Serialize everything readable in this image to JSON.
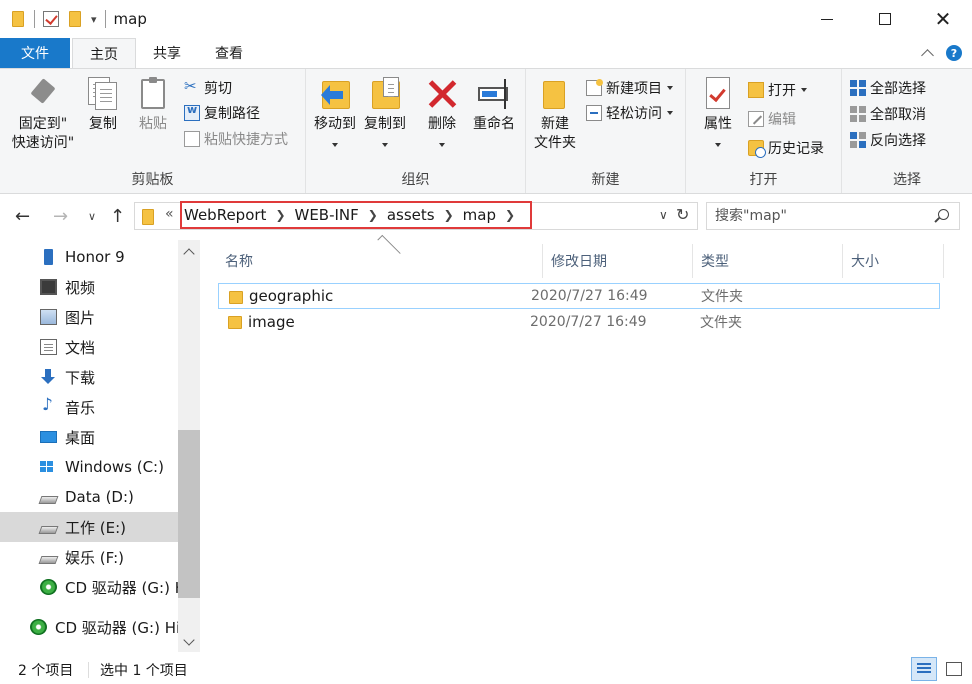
{
  "window": {
    "title": "map",
    "close_glyph": "✕"
  },
  "tabs": [
    {
      "label": "文件"
    },
    {
      "label": "主页"
    },
    {
      "label": "共享"
    },
    {
      "label": "查看"
    }
  ],
  "ribbon": {
    "clipboard": {
      "group_label": "剪贴板",
      "pin_line1": "固定到\"",
      "pin_line2": "快速访问\"",
      "copy": "复制",
      "paste": "粘贴",
      "cut": "剪切",
      "copy_path": "复制路径",
      "paste_shortcut": "粘贴快捷方式"
    },
    "organize": {
      "group_label": "组织",
      "move_to": "移动到",
      "copy_to": "复制到",
      "delete": "删除",
      "rename": "重命名"
    },
    "new": {
      "group_label": "新建",
      "new_folder_line1": "新建",
      "new_folder_line2": "文件夹",
      "new_item": "新建项目",
      "easy_access": "轻松访问"
    },
    "open": {
      "group_label": "打开",
      "properties": "属性",
      "open": "打开",
      "edit": "编辑",
      "history": "历史记录"
    },
    "select": {
      "group_label": "选择",
      "select_all": "全部选择",
      "select_none": "全部取消",
      "invert": "反向选择"
    }
  },
  "address": {
    "prefix": "«",
    "crumbs": [
      "WebReport",
      "WEB-INF",
      "assets",
      "map"
    ],
    "search_placeholder": "搜索\"map\""
  },
  "nav_pane": {
    "items": [
      {
        "label": "Honor 9",
        "icon": "phone-icon"
      },
      {
        "label": "视频",
        "icon": "video-icon"
      },
      {
        "label": "图片",
        "icon": "pictures-icon"
      },
      {
        "label": "文档",
        "icon": "documents-icon"
      },
      {
        "label": "下载",
        "icon": "download-icon"
      },
      {
        "label": "音乐",
        "icon": "music-icon"
      },
      {
        "label": "桌面",
        "icon": "desktop-icon"
      },
      {
        "label": "Windows (C:)",
        "icon": "windows-drive-icon"
      },
      {
        "label": "Data (D:)",
        "icon": "drive-icon"
      },
      {
        "label": "工作 (E:)",
        "icon": "drive-icon",
        "selected": true
      },
      {
        "label": "娱乐 (F:)",
        "icon": "drive-icon"
      },
      {
        "label": "CD 驱动器 (G:) H",
        "icon": "cd-drive-icon"
      },
      {
        "label": "CD 驱动器 (G:) HiS",
        "icon": "cd-drive-icon"
      }
    ]
  },
  "file_list": {
    "columns": [
      "名称",
      "修改日期",
      "类型",
      "大小"
    ],
    "rows": [
      {
        "name": "geographic",
        "date": "2020/7/27 16:49",
        "type": "文件夹",
        "size": "",
        "selected": true
      },
      {
        "name": "image",
        "date": "2020/7/27 16:49",
        "type": "文件夹",
        "size": "",
        "selected": false
      }
    ]
  },
  "status": {
    "item_count": "2 个项目",
    "selected_count": "选中 1 个项目"
  },
  "colors": {
    "file_tab": "#1979ca",
    "highlight_box": "#e03a3a",
    "selection_border": "#99d1ff"
  }
}
